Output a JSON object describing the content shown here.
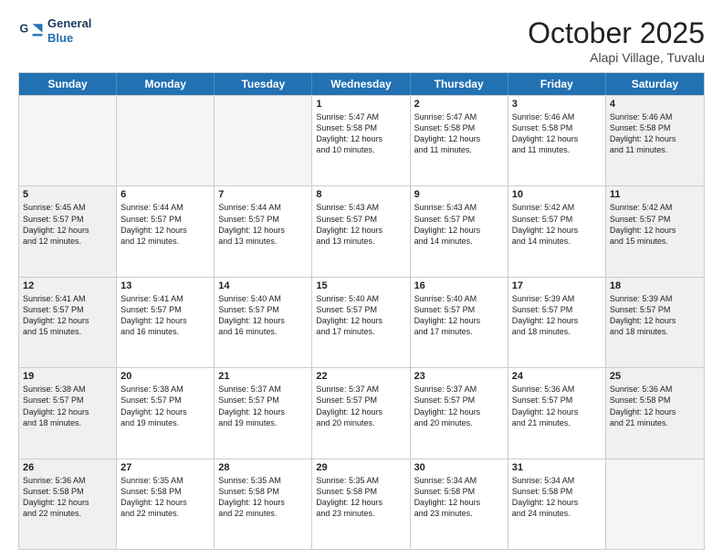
{
  "header": {
    "logo_line1": "General",
    "logo_line2": "Blue",
    "month": "October 2025",
    "location": "Alapi Village, Tuvalu"
  },
  "weekdays": [
    "Sunday",
    "Monday",
    "Tuesday",
    "Wednesday",
    "Thursday",
    "Friday",
    "Saturday"
  ],
  "rows": [
    [
      {
        "day": "",
        "text": "",
        "empty": true
      },
      {
        "day": "",
        "text": "",
        "empty": true
      },
      {
        "day": "",
        "text": "",
        "empty": true
      },
      {
        "day": "1",
        "text": "Sunrise: 5:47 AM\nSunset: 5:58 PM\nDaylight: 12 hours\nand 10 minutes.",
        "empty": false
      },
      {
        "day": "2",
        "text": "Sunrise: 5:47 AM\nSunset: 5:58 PM\nDaylight: 12 hours\nand 11 minutes.",
        "empty": false
      },
      {
        "day": "3",
        "text": "Sunrise: 5:46 AM\nSunset: 5:58 PM\nDaylight: 12 hours\nand 11 minutes.",
        "empty": false
      },
      {
        "day": "4",
        "text": "Sunrise: 5:46 AM\nSunset: 5:58 PM\nDaylight: 12 hours\nand 11 minutes.",
        "empty": false,
        "shaded": true
      }
    ],
    [
      {
        "day": "5",
        "text": "Sunrise: 5:45 AM\nSunset: 5:57 PM\nDaylight: 12 hours\nand 12 minutes.",
        "empty": false,
        "shaded": true
      },
      {
        "day": "6",
        "text": "Sunrise: 5:44 AM\nSunset: 5:57 PM\nDaylight: 12 hours\nand 12 minutes.",
        "empty": false
      },
      {
        "day": "7",
        "text": "Sunrise: 5:44 AM\nSunset: 5:57 PM\nDaylight: 12 hours\nand 13 minutes.",
        "empty": false
      },
      {
        "day": "8",
        "text": "Sunrise: 5:43 AM\nSunset: 5:57 PM\nDaylight: 12 hours\nand 13 minutes.",
        "empty": false
      },
      {
        "day": "9",
        "text": "Sunrise: 5:43 AM\nSunset: 5:57 PM\nDaylight: 12 hours\nand 14 minutes.",
        "empty": false
      },
      {
        "day": "10",
        "text": "Sunrise: 5:42 AM\nSunset: 5:57 PM\nDaylight: 12 hours\nand 14 minutes.",
        "empty": false
      },
      {
        "day": "11",
        "text": "Sunrise: 5:42 AM\nSunset: 5:57 PM\nDaylight: 12 hours\nand 15 minutes.",
        "empty": false,
        "shaded": true
      }
    ],
    [
      {
        "day": "12",
        "text": "Sunrise: 5:41 AM\nSunset: 5:57 PM\nDaylight: 12 hours\nand 15 minutes.",
        "empty": false,
        "shaded": true
      },
      {
        "day": "13",
        "text": "Sunrise: 5:41 AM\nSunset: 5:57 PM\nDaylight: 12 hours\nand 16 minutes.",
        "empty": false
      },
      {
        "day": "14",
        "text": "Sunrise: 5:40 AM\nSunset: 5:57 PM\nDaylight: 12 hours\nand 16 minutes.",
        "empty": false
      },
      {
        "day": "15",
        "text": "Sunrise: 5:40 AM\nSunset: 5:57 PM\nDaylight: 12 hours\nand 17 minutes.",
        "empty": false
      },
      {
        "day": "16",
        "text": "Sunrise: 5:40 AM\nSunset: 5:57 PM\nDaylight: 12 hours\nand 17 minutes.",
        "empty": false
      },
      {
        "day": "17",
        "text": "Sunrise: 5:39 AM\nSunset: 5:57 PM\nDaylight: 12 hours\nand 18 minutes.",
        "empty": false
      },
      {
        "day": "18",
        "text": "Sunrise: 5:39 AM\nSunset: 5:57 PM\nDaylight: 12 hours\nand 18 minutes.",
        "empty": false,
        "shaded": true
      }
    ],
    [
      {
        "day": "19",
        "text": "Sunrise: 5:38 AM\nSunset: 5:57 PM\nDaylight: 12 hours\nand 18 minutes.",
        "empty": false,
        "shaded": true
      },
      {
        "day": "20",
        "text": "Sunrise: 5:38 AM\nSunset: 5:57 PM\nDaylight: 12 hours\nand 19 minutes.",
        "empty": false
      },
      {
        "day": "21",
        "text": "Sunrise: 5:37 AM\nSunset: 5:57 PM\nDaylight: 12 hours\nand 19 minutes.",
        "empty": false
      },
      {
        "day": "22",
        "text": "Sunrise: 5:37 AM\nSunset: 5:57 PM\nDaylight: 12 hours\nand 20 minutes.",
        "empty": false
      },
      {
        "day": "23",
        "text": "Sunrise: 5:37 AM\nSunset: 5:57 PM\nDaylight: 12 hours\nand 20 minutes.",
        "empty": false
      },
      {
        "day": "24",
        "text": "Sunrise: 5:36 AM\nSunset: 5:57 PM\nDaylight: 12 hours\nand 21 minutes.",
        "empty": false
      },
      {
        "day": "25",
        "text": "Sunrise: 5:36 AM\nSunset: 5:58 PM\nDaylight: 12 hours\nand 21 minutes.",
        "empty": false,
        "shaded": true
      }
    ],
    [
      {
        "day": "26",
        "text": "Sunrise: 5:36 AM\nSunset: 5:58 PM\nDaylight: 12 hours\nand 22 minutes.",
        "empty": false,
        "shaded": true
      },
      {
        "day": "27",
        "text": "Sunrise: 5:35 AM\nSunset: 5:58 PM\nDaylight: 12 hours\nand 22 minutes.",
        "empty": false
      },
      {
        "day": "28",
        "text": "Sunrise: 5:35 AM\nSunset: 5:58 PM\nDaylight: 12 hours\nand 22 minutes.",
        "empty": false
      },
      {
        "day": "29",
        "text": "Sunrise: 5:35 AM\nSunset: 5:58 PM\nDaylight: 12 hours\nand 23 minutes.",
        "empty": false
      },
      {
        "day": "30",
        "text": "Sunrise: 5:34 AM\nSunset: 5:58 PM\nDaylight: 12 hours\nand 23 minutes.",
        "empty": false
      },
      {
        "day": "31",
        "text": "Sunrise: 5:34 AM\nSunset: 5:58 PM\nDaylight: 12 hours\nand 24 minutes.",
        "empty": false
      },
      {
        "day": "",
        "text": "",
        "empty": true,
        "shaded": true
      }
    ]
  ]
}
